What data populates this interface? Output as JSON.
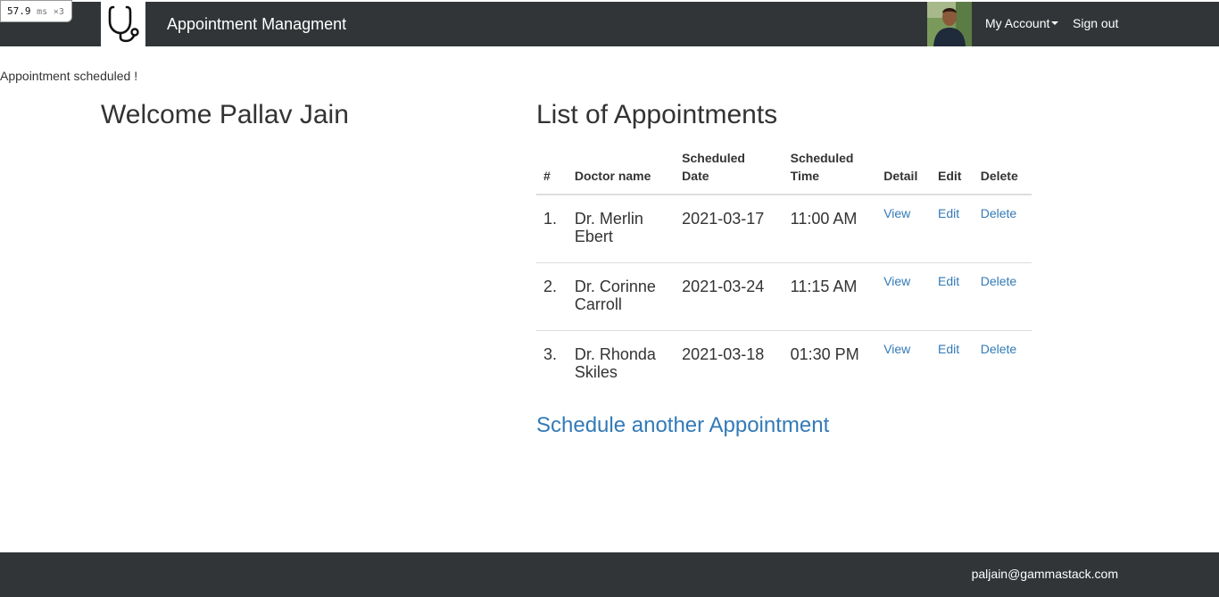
{
  "perf": {
    "value": "57.9",
    "unit": "ms",
    "multiplier": "×3"
  },
  "navbar": {
    "title": "Appointment Managment",
    "logo_icon": "stethoscope-icon",
    "my_account": "My Account",
    "sign_out": "Sign out"
  },
  "flash_message": "Appointment scheduled !",
  "welcome": "Welcome Pallav Jain",
  "list": {
    "title": "List of Appointments",
    "headers": {
      "num": "#",
      "doctor": "Doctor name",
      "date_line1": "Scheduled",
      "date_line2": "Date",
      "time_line1": "Scheduled",
      "time_line2": "Time",
      "detail": "Detail",
      "edit": "Edit",
      "delete": "Delete"
    },
    "rows": [
      {
        "num": "1.",
        "doctor_first": "Dr. Merlin",
        "doctor_last": "Ebert",
        "date": "2021-03-17",
        "time": "11:00 AM",
        "view": "View",
        "edit": "Edit",
        "delete": "Delete"
      },
      {
        "num": "2.",
        "doctor_first": "Dr. Corinne",
        "doctor_last": "Carroll",
        "date": "2021-03-24",
        "time": "11:15 AM",
        "view": "View",
        "edit": "Edit",
        "delete": "Delete"
      },
      {
        "num": "3.",
        "doctor_first": "Dr. Rhonda",
        "doctor_last": "Skiles",
        "date": "2021-03-18",
        "time": "01:30 PM",
        "view": "View",
        "edit": "Edit",
        "delete": "Delete"
      }
    ]
  },
  "schedule_link": "Schedule another Appointment",
  "footer": {
    "email": "paljain@gammastack.com"
  },
  "colors": {
    "navbar_bg": "#313537",
    "link": "#337ab7",
    "text": "#333333"
  }
}
